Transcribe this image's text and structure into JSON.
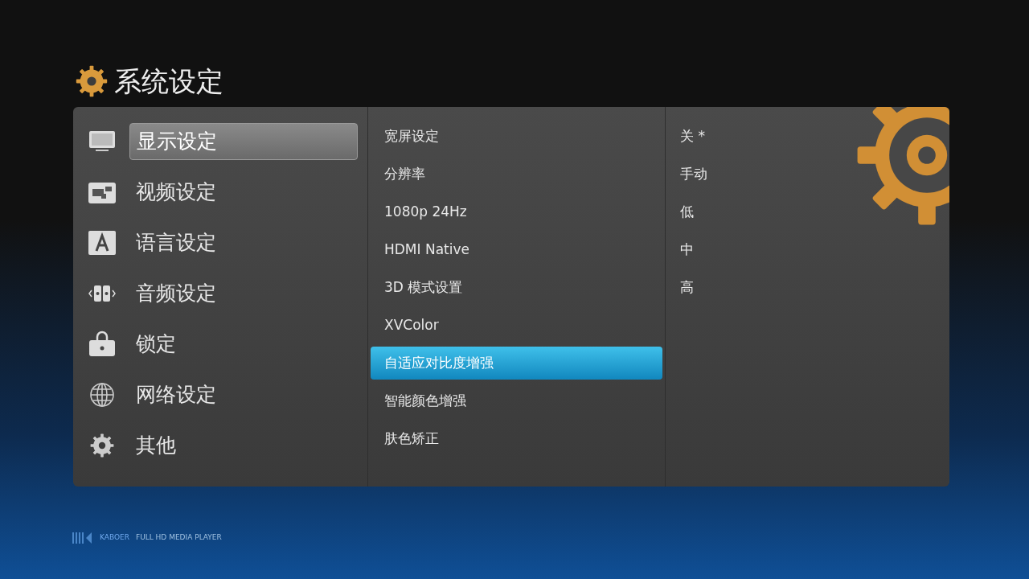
{
  "header": {
    "title": "系统设定"
  },
  "categories": [
    {
      "label": "显示设定",
      "kind": "monitor",
      "selected": true
    },
    {
      "label": "视频设定",
      "kind": "video",
      "selected": false
    },
    {
      "label": "语言设定",
      "kind": "language",
      "selected": false
    },
    {
      "label": "音频设定",
      "kind": "audio",
      "selected": false
    },
    {
      "label": "锁定",
      "kind": "lock",
      "selected": false
    },
    {
      "label": "网络设定",
      "kind": "globe",
      "selected": false
    },
    {
      "label": "其他",
      "kind": "gear",
      "selected": false
    }
  ],
  "settings": [
    {
      "label": "宽屏设定",
      "selected": false
    },
    {
      "label": "分辨率",
      "selected": false
    },
    {
      "label": "1080p 24Hz",
      "selected": false
    },
    {
      "label": "HDMI Native",
      "selected": false
    },
    {
      "label": "3D 模式设置",
      "selected": false
    },
    {
      "label": "XVColor",
      "selected": false
    },
    {
      "label": "自适应对比度增强",
      "selected": true
    },
    {
      "label": "智能颜色增强",
      "selected": false
    },
    {
      "label": "肤色矫正",
      "selected": false
    }
  ],
  "options": [
    "关 *",
    "手动",
    "低",
    "中",
    "高"
  ],
  "footer": {
    "brand": "KABOER",
    "tagline": "FULL HD MEDIA PLAYER"
  }
}
